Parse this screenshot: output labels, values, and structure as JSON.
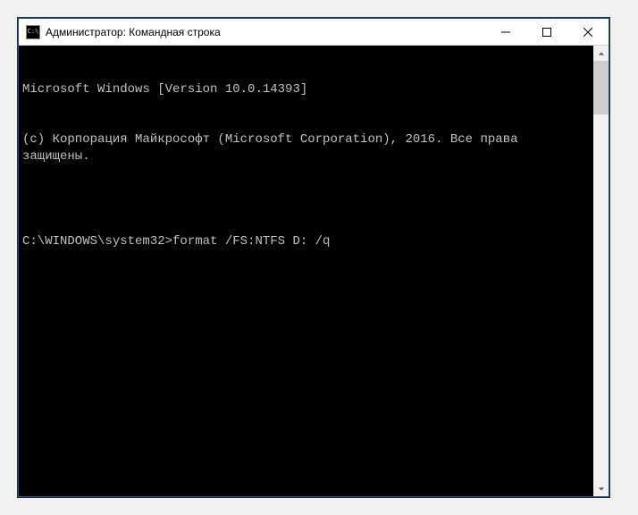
{
  "titlebar": {
    "title": "Администратор: Командная строка",
    "icon_label": "C:\\"
  },
  "terminal": {
    "line1": "Microsoft Windows [Version 10.0.14393]",
    "line2": "(c) Корпорация Майкрософт (Microsoft Corporation), 2016. Все права защищены.",
    "blank": "",
    "prompt": "C:\\WINDOWS\\system32>",
    "command": "format /FS:NTFS D: /q"
  }
}
